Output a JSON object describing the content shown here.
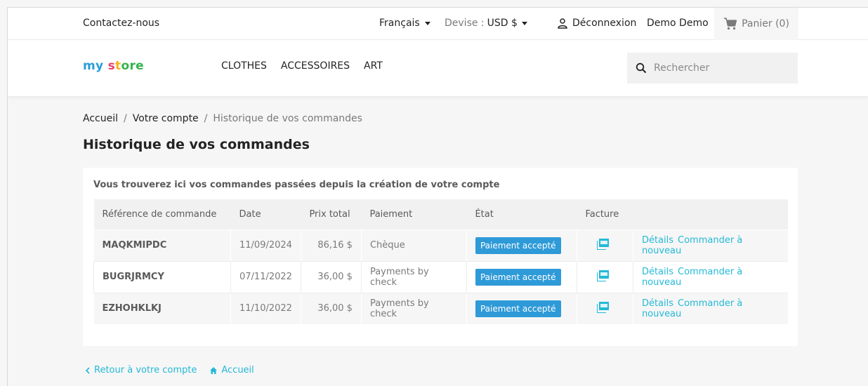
{
  "topnav": {
    "contact": "Contactez-nous",
    "language": "Français",
    "currency_label": "Devise :",
    "currency_value": "USD $",
    "logout": "Déconnexion",
    "username": "Demo Demo",
    "cart": "Panier (0)"
  },
  "header": {
    "logo": [
      "my",
      " ",
      "s",
      "t",
      "ore"
    ],
    "menu": [
      "CLOTHES",
      "ACCESSOIRES",
      "ART"
    ],
    "search_placeholder": "Rechercher"
  },
  "breadcrumb": [
    "Accueil",
    "Votre compte",
    "Historique de vos commandes"
  ],
  "page_title": "Historique de vos commandes",
  "intro": "Vous trouverez ici vos commandes passées depuis la création de votre compte",
  "table": {
    "headers": [
      "Référence de commande",
      "Date",
      "Prix total",
      "Paiement",
      "État",
      "Facture",
      ""
    ],
    "rows": [
      {
        "ref": "MAQKMIPDC",
        "date": "11/09/2024",
        "total": "86,16 $",
        "payment": "Chèque",
        "status": "Paiement accepté",
        "details": "Détails",
        "reorder": "Commander à nouveau"
      },
      {
        "ref": "BUGRJRMCY",
        "date": "07/11/2022",
        "total": "36,00 $",
        "payment": "Payments by check",
        "status": "Paiement accepté",
        "details": "Détails",
        "reorder": "Commander à nouveau"
      },
      {
        "ref": "EZHOHKLKJ",
        "date": "11/10/2022",
        "total": "36,00 $",
        "payment": "Payments by check",
        "status": "Paiement accepté",
        "details": "Détails",
        "reorder": "Commander à nouveau"
      }
    ]
  },
  "footer_links": {
    "back": "Retour à votre compte",
    "home": "Accueil"
  },
  "colors": {
    "accent": "#24b9d7",
    "badge": "#2e9ad8"
  }
}
